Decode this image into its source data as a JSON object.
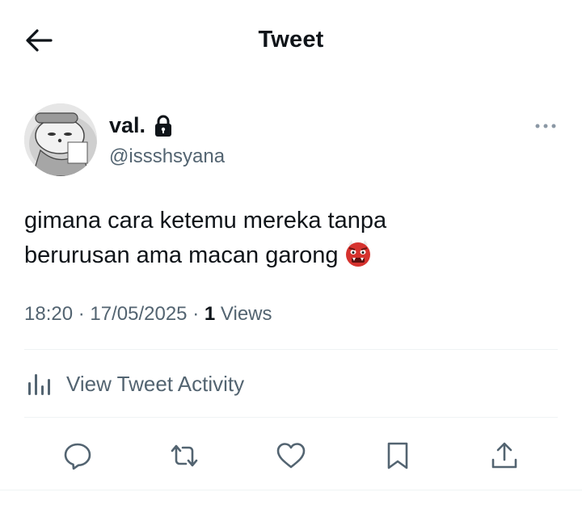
{
  "header": {
    "title": "Tweet",
    "back_icon": "arrow-left-icon"
  },
  "author": {
    "display_name": "val.",
    "handle": "@issshsyana",
    "protected_icon": "lock-icon",
    "more_icon": "more-horizontal-icon"
  },
  "tweet": {
    "text_line1": "gimana cara ketemu mereka tanpa",
    "text_line2": "berurusan ama macan garong",
    "emoji": "ogre-emoji"
  },
  "meta": {
    "time": "18:20",
    "separator": "·",
    "date": "17/05/2025",
    "views_count": "1",
    "views_label": "Views"
  },
  "activity": {
    "label": "View Tweet Activity",
    "icon": "bar-chart-icon"
  },
  "actions": [
    "reply-icon",
    "retweet-icon",
    "like-icon",
    "bookmark-icon",
    "share-icon"
  ],
  "colors": {
    "text": "#0f1419",
    "secondary": "#536471",
    "divider": "#eff3f4"
  }
}
